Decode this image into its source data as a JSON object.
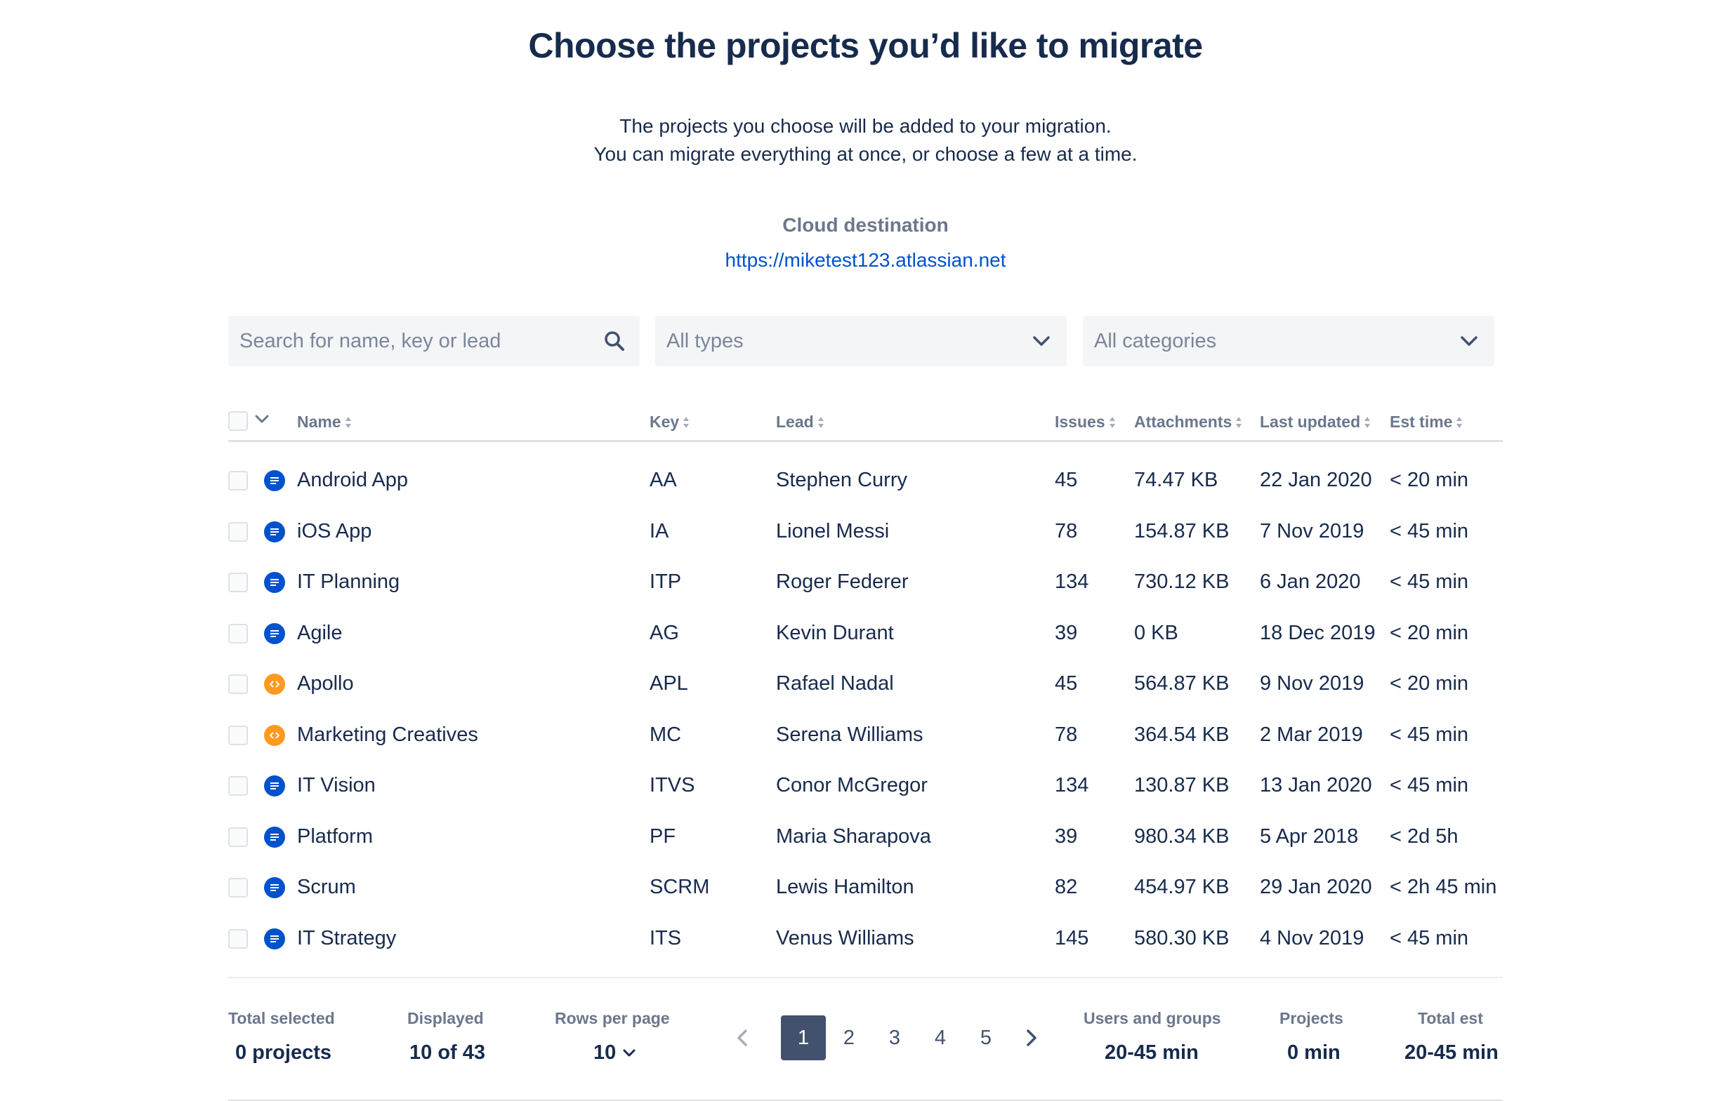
{
  "header": {
    "title": "Choose the projects you’d like to migrate",
    "subtitle_line1": "The projects you choose will be added to your migration.",
    "subtitle_line2": "You can migrate everything at once, or choose a few at a time.",
    "destination_label": "Cloud destination",
    "destination_url": "https://miketest123.atlassian.net"
  },
  "filters": {
    "search_placeholder": "Search for name, key or lead",
    "search_value": "",
    "type_selected": "All types",
    "category_selected": "All categories"
  },
  "table": {
    "columns": {
      "name": "Name",
      "key": "Key",
      "lead": "Lead",
      "issues": "Issues",
      "attachments": "Attachments",
      "last_updated": "Last updated",
      "est_time": "Est time"
    },
    "rows": [
      {
        "icon": "software-project-icon",
        "type": "software",
        "name": "Android App",
        "key": "AA",
        "lead": "Stephen Curry",
        "issues": "45",
        "attachments": "74.47 KB",
        "last_updated": "22 Jan 2020",
        "est_time": "< 20 min",
        "selected": false
      },
      {
        "icon": "software-project-icon",
        "type": "software",
        "name": "iOS App",
        "key": "IA",
        "lead": "Lionel Messi",
        "issues": "78",
        "attachments": "154.87 KB",
        "last_updated": "7 Nov 2019",
        "est_time": "< 45 min",
        "selected": false
      },
      {
        "icon": "software-project-icon",
        "type": "software",
        "name": "IT Planning",
        "key": "ITP",
        "lead": "Roger Federer",
        "issues": "134",
        "attachments": "730.12 KB",
        "last_updated": "6 Jan 2020",
        "est_time": "< 45 min",
        "selected": false
      },
      {
        "icon": "software-project-icon",
        "type": "software",
        "name": "Agile",
        "key": "AG",
        "lead": "Kevin Durant",
        "issues": "39",
        "attachments": "0 KB",
        "last_updated": "18 Dec 2019",
        "est_time": "< 20 min",
        "selected": false
      },
      {
        "icon": "business-project-icon",
        "type": "business",
        "name": "Apollo",
        "key": "APL",
        "lead": "Rafael Nadal",
        "issues": "45",
        "attachments": "564.87 KB",
        "last_updated": "9 Nov 2019",
        "est_time": "< 20 min",
        "selected": false
      },
      {
        "icon": "business-project-icon",
        "type": "business",
        "name": "Marketing Creatives",
        "key": "MC",
        "lead": "Serena Williams",
        "issues": "78",
        "attachments": "364.54 KB",
        "last_updated": "2 Mar 2019",
        "est_time": "< 45 min",
        "selected": false
      },
      {
        "icon": "software-project-icon",
        "type": "software",
        "name": "IT Vision",
        "key": "ITVS",
        "lead": "Conor McGregor",
        "issues": "134",
        "attachments": "130.87 KB",
        "last_updated": "13 Jan 2020",
        "est_time": "< 45 min",
        "selected": false
      },
      {
        "icon": "software-project-icon",
        "type": "software",
        "name": "Platform",
        "key": "PF",
        "lead": "Maria Sharapova",
        "issues": "39",
        "attachments": "980.34 KB",
        "last_updated": "5 Apr 2018",
        "est_time": "< 2d 5h",
        "selected": false
      },
      {
        "icon": "software-project-icon",
        "type": "software",
        "name": "Scrum",
        "key": "SCRM",
        "lead": "Lewis Hamilton",
        "issues": "82",
        "attachments": "454.97 KB",
        "last_updated": "29 Jan 2020",
        "est_time": "< 2h 45 min",
        "selected": false
      },
      {
        "icon": "software-project-icon",
        "type": "software",
        "name": "IT Strategy",
        "key": "ITS",
        "lead": "Venus Williams",
        "issues": "145",
        "attachments": "580.30 KB",
        "last_updated": "4 Nov 2019",
        "est_time": "< 45 min",
        "selected": false
      }
    ]
  },
  "footer": {
    "total_selected_label": "Total selected",
    "total_selected_value": "0 projects",
    "displayed_label": "Displayed",
    "displayed_value": "10 of 43",
    "rows_per_page_label": "Rows per page",
    "rows_per_page_value": "10",
    "pages": [
      "1",
      "2",
      "3",
      "4",
      "5"
    ],
    "current_page": "1",
    "users_groups_label": "Users and groups",
    "users_groups_value": "20-45 min",
    "projects_label": "Projects",
    "projects_value": "0 min",
    "total_est_label": "Total est",
    "total_est_value": "20-45 min"
  },
  "colors": {
    "primary_text": "#172B4D",
    "secondary_text": "#6B778C",
    "link": "#0052CC",
    "software_icon": "#0052CC",
    "business_icon": "#FF991F",
    "active_page": "#42526E",
    "field_background": "#F4F5F7"
  }
}
